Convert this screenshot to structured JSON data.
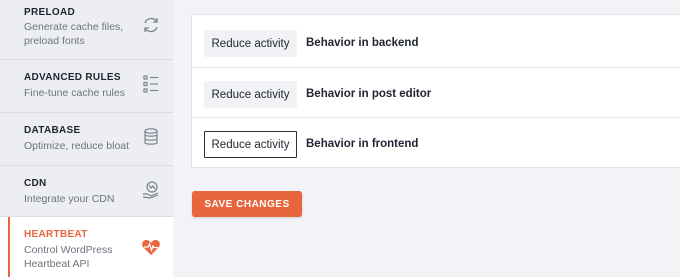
{
  "sidebar": {
    "items": [
      {
        "title": "PRELOAD",
        "subtitle": "Generate cache files, preload fonts",
        "icon": "refresh-icon"
      },
      {
        "title": "ADVANCED RULES",
        "subtitle": "Fine-tune cache rules",
        "icon": "rules-list-icon"
      },
      {
        "title": "DATABASE",
        "subtitle": "Optimize, reduce bloat",
        "icon": "database-icon"
      },
      {
        "title": "CDN",
        "subtitle": "Integrate your CDN",
        "icon": "cdn-globe-hand-icon"
      },
      {
        "title": "HEARTBEAT",
        "subtitle": "Control WordPress Heartbeat API",
        "icon": "heartbeat-icon"
      }
    ],
    "active_index": 4
  },
  "heartbeat": {
    "rows": [
      {
        "button": "Reduce activity",
        "label": "Behavior in backend"
      },
      {
        "button": "Reduce activity",
        "label": "Behavior in post editor"
      },
      {
        "button": "Reduce activity",
        "label": "Behavior in frontend"
      }
    ]
  },
  "actions": {
    "save_label": "SAVE CHANGES"
  },
  "colors": {
    "accent": "#e8663d",
    "sidebar_bg": "#eceef2",
    "page_bg": "#f2f3f6"
  }
}
